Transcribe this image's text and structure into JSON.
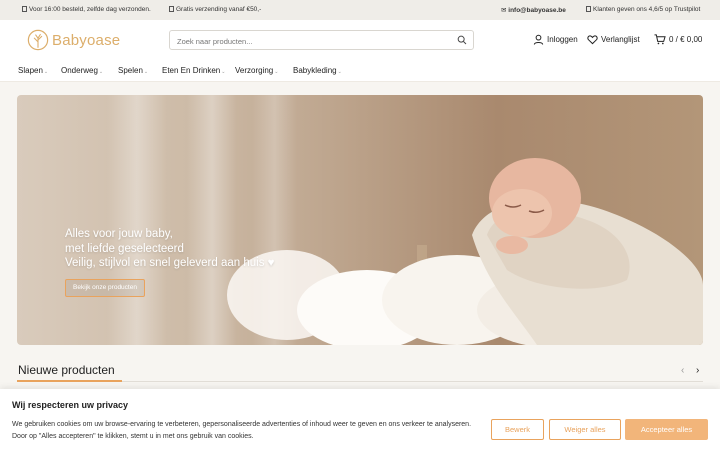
{
  "topbar": {
    "left1": "Voor 16:00 besteld, zelfde dag verzonden.",
    "left2": "Gratis verzending vanaf €50,-",
    "email": "info@babyoase.be",
    "trustpilot": "Klanten geven ons 4,6/5 op Trustpilot"
  },
  "header": {
    "logo_text": "Babyoase",
    "search_placeholder": "Zoek naar producten...",
    "login": "Inloggen",
    "wishlist": "Verlanglijst",
    "cart": "0 / € 0,00"
  },
  "nav": {
    "items": [
      {
        "label": "Slapen",
        "has_dropdown": true
      },
      {
        "label": "Onderweg",
        "has_dropdown": true
      },
      {
        "label": "Spelen",
        "has_dropdown": true
      },
      {
        "label": "Eten En Drinken",
        "has_dropdown": true
      },
      {
        "label": "Verzorging",
        "has_dropdown": true
      },
      {
        "label": "Babykleding",
        "has_dropdown": true
      }
    ]
  },
  "hero": {
    "line1": "Alles voor jouw baby,",
    "line2": "met liefde geselecteerd",
    "line3": "Veilig, stijlvol en snel geleverd aan huis ♥",
    "button": "Bekijk onze producten"
  },
  "section": {
    "title": "Nieuwe producten",
    "prev": "‹",
    "next": "›"
  },
  "cookie": {
    "title": "Wij respecteren uw privacy",
    "text": "We gebruiken cookies om uw browse-ervaring te verbeteren, gepersonaliseerde advertenties of inhoud weer te geven en ons verkeer te analyseren. Door op \"Alles accepteren\" te klikken, stemt u in met ons gebruik van cookies.",
    "btn_customize": "Bewerk",
    "btn_reject": "Weiger alles",
    "btn_accept": "Accepteer alles"
  },
  "colors": {
    "accent": "#e9a35d",
    "logo": "#dcae6b",
    "accept_bg": "#f2b57a"
  }
}
